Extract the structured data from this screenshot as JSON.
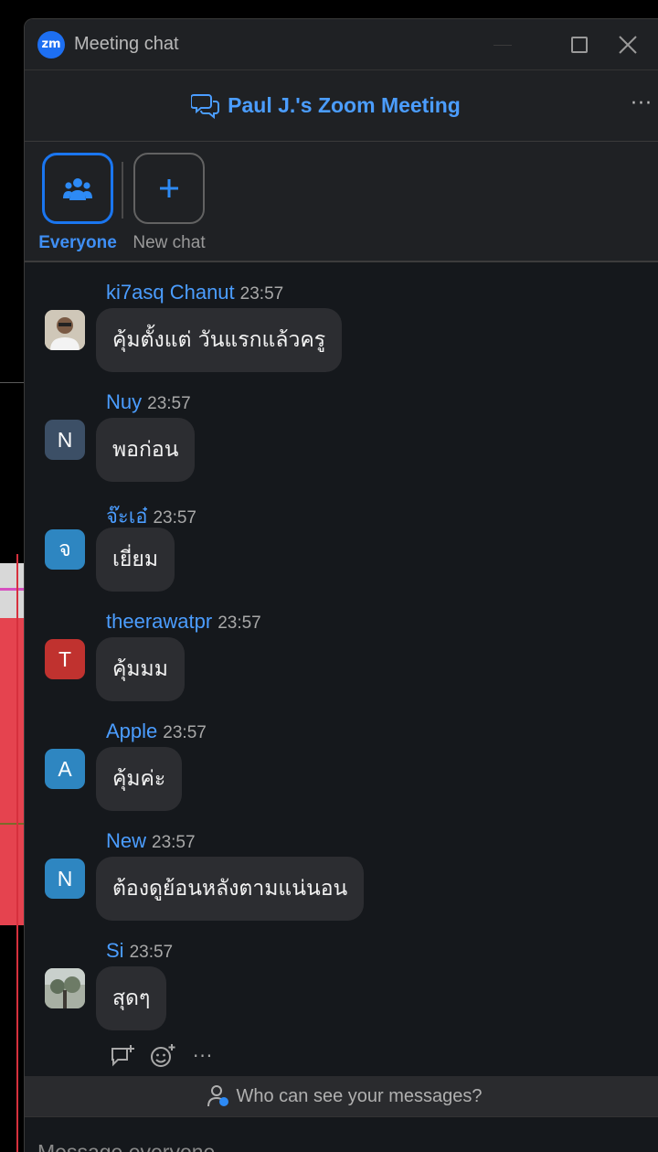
{
  "window": {
    "title": "Meeting chat",
    "logo_text": "zm"
  },
  "header": {
    "meeting_title": "Paul J.'s Zoom Meeting",
    "more": "···"
  },
  "tabs": [
    {
      "label": "Everyone",
      "active": true,
      "icon": "people-icon"
    },
    {
      "label": "New chat",
      "active": false,
      "icon": "plus-icon"
    }
  ],
  "messages": [
    {
      "sender": "ki7asq Chanut",
      "time": "23:57",
      "text": "คุ้มตั้งแต่ วันแรกแล้วครู",
      "avatar_type": "photo",
      "avatar_letter": "",
      "avatar_color": "#d9d2c6"
    },
    {
      "sender": "Nuy",
      "time": "23:57",
      "text": "พอก่อน",
      "avatar_type": "letter",
      "avatar_letter": "N",
      "avatar_color": "#3c4f66"
    },
    {
      "sender": "จ๊ะเอ๋",
      "time": "23:57",
      "text": "เยี่ยม",
      "avatar_type": "letter",
      "avatar_letter": "จ",
      "avatar_color": "#2e86c1"
    },
    {
      "sender": "theerawatpr",
      "time": "23:57",
      "text": "คุ้มมม",
      "avatar_type": "letter",
      "avatar_letter": "T",
      "avatar_color": "#c0322f"
    },
    {
      "sender": "Apple",
      "time": "23:57",
      "text": "คุ้มค่ะ",
      "avatar_type": "letter",
      "avatar_letter": "A",
      "avatar_color": "#2e86c1"
    },
    {
      "sender": "New",
      "time": "23:57",
      "text": "ต้องดูย้อนหลังตามแน่นอน",
      "avatar_type": "letter",
      "avatar_letter": "N",
      "avatar_color": "#2e86c1"
    },
    {
      "sender": "Si",
      "time": "23:57",
      "text": "สุดๆ",
      "avatar_type": "photo",
      "avatar_letter": "",
      "avatar_color": "#8f9a8c"
    }
  ],
  "reactions": {
    "more": "···"
  },
  "visibility": {
    "text": "Who can see your messages?"
  },
  "composer": {
    "placeholder": "Message everyone"
  },
  "colors": {
    "accent": "#1a76f0",
    "sender_name": "#4b9dff",
    "bubble": "#2c2d31",
    "background": "#15181c"
  }
}
